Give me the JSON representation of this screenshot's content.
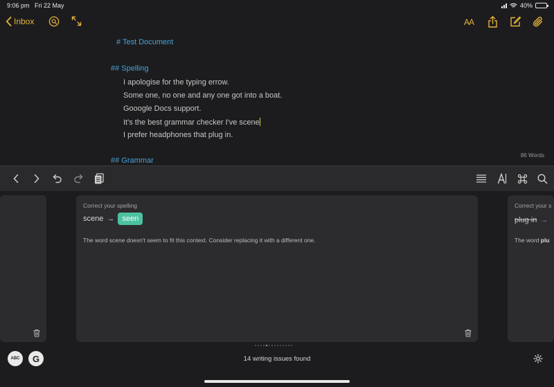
{
  "status": {
    "time": "9:06 pm",
    "date": "Fri 22 May",
    "battery": "40%",
    "battery_level": 0.4
  },
  "nav": {
    "back_label": "Inbox",
    "text_size_label": "AA"
  },
  "document": {
    "title": "# Test Document",
    "spelling_heading": "## Spelling",
    "lines": [
      "I apologise for the typing errow.",
      "Some one, no one and any one got into a boat.",
      "Gooogle Docs support.",
      "It's the best grammar checker I've scene",
      "I prefer headphones that plug in."
    ],
    "grammar_heading": "## Grammar",
    "word_count": "86 Words"
  },
  "cards": {
    "main": {
      "label": "Correct your spelling",
      "original": "scene",
      "arrow": "→",
      "replacement": "seen",
      "description": "The word scene doesn't seem to fit this context. Consider replacing it with a different one."
    },
    "right": {
      "label": "Correct your s",
      "original": "plug in",
      "arrow": "→",
      "description_start": "The word ",
      "description_bold": "plu"
    }
  },
  "footer": {
    "issues": "14 writing issues found",
    "abc_label": "ABC",
    "g_label": "G"
  }
}
